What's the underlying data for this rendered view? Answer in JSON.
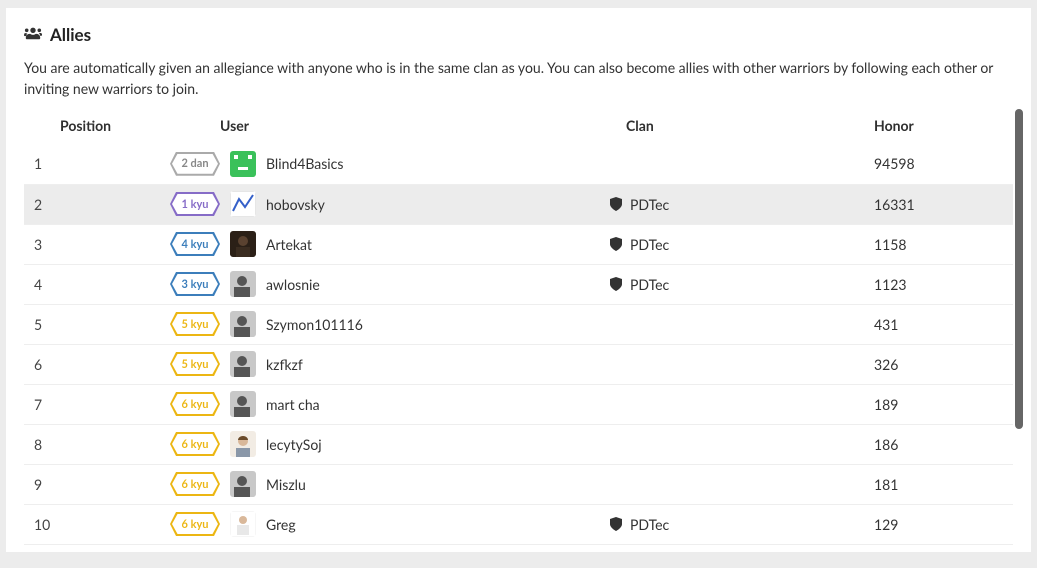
{
  "header": {
    "title": "Allies",
    "description": "You are automatically given an allegiance with anyone who is in the same clan as you. You can also become allies with other warriors by following each other or inviting new warriors to join."
  },
  "table": {
    "columns": {
      "position": "Position",
      "user": "User",
      "clan": "Clan",
      "honor": "Honor"
    },
    "rows": [
      {
        "position": "1",
        "rank": "2 dan",
        "rank_color": "gray",
        "username": "Blind4Basics",
        "clan": "",
        "honor": "94598",
        "highlight": false,
        "avatar": "green"
      },
      {
        "position": "2",
        "rank": "1 kyu",
        "rank_color": "purple",
        "username": "hobovsky",
        "clan": "PDTec",
        "honor": "16331",
        "highlight": true,
        "avatar": "chart"
      },
      {
        "position": "3",
        "rank": "4 kyu",
        "rank_color": "blue",
        "username": "Artekat",
        "clan": "PDTec",
        "honor": "1158",
        "highlight": false,
        "avatar": "dark"
      },
      {
        "position": "4",
        "rank": "3 kyu",
        "rank_color": "blue",
        "username": "awlosnie",
        "clan": "PDTec",
        "honor": "1123",
        "highlight": false,
        "avatar": "gray"
      },
      {
        "position": "5",
        "rank": "5 kyu",
        "rank_color": "yellow",
        "username": "Szymon101116",
        "clan": "",
        "honor": "431",
        "highlight": false,
        "avatar": "gray"
      },
      {
        "position": "6",
        "rank": "5 kyu",
        "rank_color": "yellow",
        "username": "kzfkzf",
        "clan": "",
        "honor": "326",
        "highlight": false,
        "avatar": "gray"
      },
      {
        "position": "7",
        "rank": "6 kyu",
        "rank_color": "yellow",
        "username": "mart cha",
        "clan": "",
        "honor": "189",
        "highlight": false,
        "avatar": "gray"
      },
      {
        "position": "8",
        "rank": "6 kyu",
        "rank_color": "yellow",
        "username": "lecytySoj",
        "clan": "",
        "honor": "186",
        "highlight": false,
        "avatar": "photo"
      },
      {
        "position": "9",
        "rank": "6 kyu",
        "rank_color": "yellow",
        "username": "Miszlu",
        "clan": "",
        "honor": "181",
        "highlight": false,
        "avatar": "gray"
      },
      {
        "position": "10",
        "rank": "6 kyu",
        "rank_color": "yellow",
        "username": "Greg",
        "clan": "PDTec",
        "honor": "129",
        "highlight": false,
        "avatar": "white"
      }
    ]
  }
}
